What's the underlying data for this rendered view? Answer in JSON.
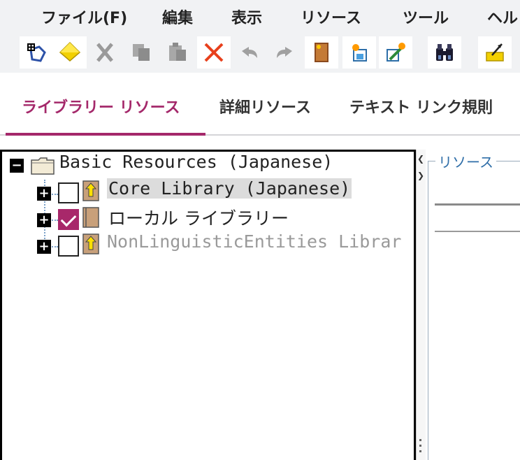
{
  "menu": {
    "file": "ファイル(F)",
    "edit": "編集",
    "view": "表示",
    "resources": "リソース",
    "tools": "ツール",
    "help": "ヘル"
  },
  "toolbar": {
    "icons": [
      "new-icon",
      "diamond-icon",
      "cut-icon",
      "copy-icon",
      "paste-icon",
      "delete-icon",
      "undo-icon",
      "redo-icon",
      "book-icon",
      "import-icon",
      "edit-resource-icon",
      "find-icon",
      "export-icon"
    ]
  },
  "tabs": {
    "library": "ライブラリー リソース",
    "detail": "詳細リソース",
    "text_link": "テキスト リンク規則",
    "active": "library"
  },
  "tree": {
    "root": {
      "label": "Basic Resources (Japanese)",
      "expanded": true
    },
    "children": [
      {
        "label": "Core Library (Japanese)",
        "checked": false,
        "selected": true,
        "muted": false
      },
      {
        "label": "ローカル ライブラリー",
        "checked": true,
        "selected": false,
        "muted": false
      },
      {
        "label": "NonLinguisticEntities Librar",
        "checked": false,
        "selected": false,
        "muted": true
      }
    ]
  },
  "right_panel": {
    "legend": "リソース"
  },
  "colors": {
    "accent": "#a4286a",
    "menu_bg": "#f1f2f4",
    "legend_text": "#2f6ea8"
  }
}
